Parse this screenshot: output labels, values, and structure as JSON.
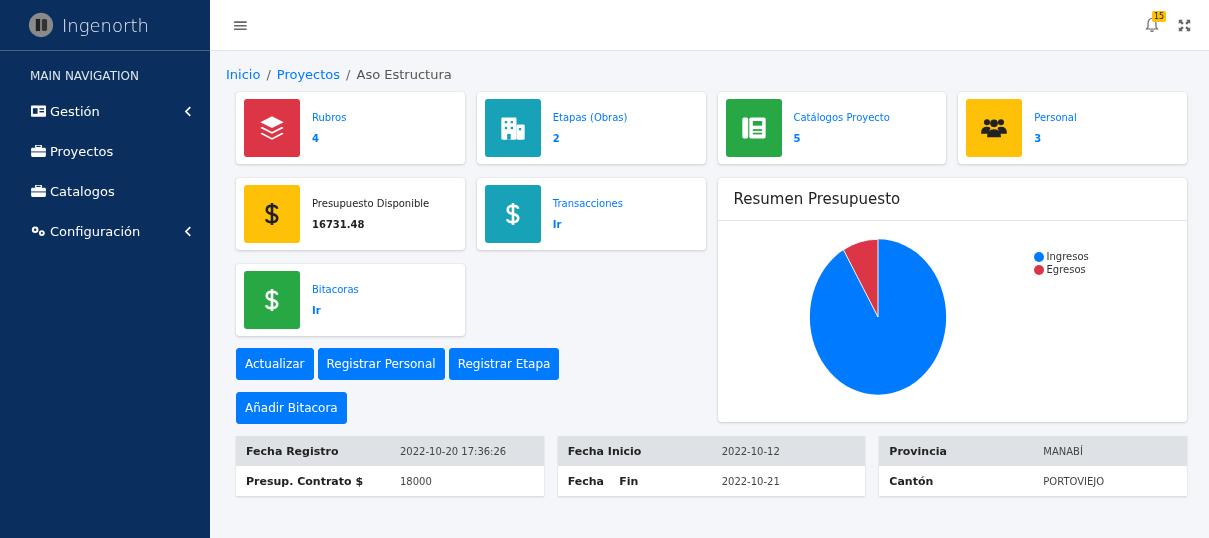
{
  "brand": {
    "name": "Ingenorth"
  },
  "sidebar": {
    "header": "MAIN NAVIGATION",
    "items": [
      {
        "label": "Gestión",
        "has_submenu": true
      },
      {
        "label": "Proyectos",
        "has_submenu": false
      },
      {
        "label": "Catalogos",
        "has_submenu": false
      },
      {
        "label": "Configuración",
        "has_submenu": true
      }
    ]
  },
  "topbar": {
    "menu_glyph": "≡",
    "notifications": "15"
  },
  "breadcrumb_separator": "/",
  "breadcrumb": [
    {
      "label": "Inicio",
      "link": true
    },
    {
      "label": "Proyectos",
      "link": true
    },
    {
      "label": "Aso Estructura",
      "link": false
    }
  ],
  "info_boxes": [
    {
      "label": "Rubros",
      "value": "4",
      "color": "#dc3545",
      "link": true
    },
    {
      "label": "Etapas (Obras)",
      "value": "2",
      "color": "#17a2b8",
      "link": true
    },
    {
      "label": "Catálogos Proyecto",
      "value": "5",
      "color": "#28a745",
      "link": true
    },
    {
      "label": "Personal",
      "value": "3",
      "color": "#ffc107",
      "link": true
    },
    {
      "label": "Presupuesto Disponible",
      "value": "16731.48",
      "color": "#ffc107",
      "link": false
    },
    {
      "label": "Transacciones",
      "value": "Ir",
      "color": "#17a2b8",
      "link": true
    },
    {
      "label": "Bitacoras",
      "value": "Ir",
      "color": "#28a745",
      "link": true
    }
  ],
  "buttons": [
    "Actualizar",
    "Registrar Personal",
    "Registrar Etapa",
    "Añadir Bitacora"
  ],
  "chart": {
    "title": "Resumen Presupuesto",
    "legend": [
      {
        "label": "Ingresos",
        "color": "#007bff"
      },
      {
        "label": "Egresos",
        "color": "#dc3545"
      }
    ]
  },
  "tables": [
    {
      "rows": [
        {
          "label": "Fecha Registro",
          "value": "2022-10-20 17:36:26"
        },
        {
          "label": "Presup. Contrato $",
          "value": "18000"
        }
      ]
    },
    {
      "rows": [
        {
          "label": "Fecha Inicio",
          "value": "2022-10-12"
        },
        {
          "label": "Fecha    Fin",
          "value": "2022-10-21"
        }
      ]
    },
    {
      "rows": [
        {
          "label": "Provincia",
          "value": "MANABÍ"
        },
        {
          "label": "Cantón",
          "value": "PORTOVIEJO"
        }
      ]
    }
  ]
}
